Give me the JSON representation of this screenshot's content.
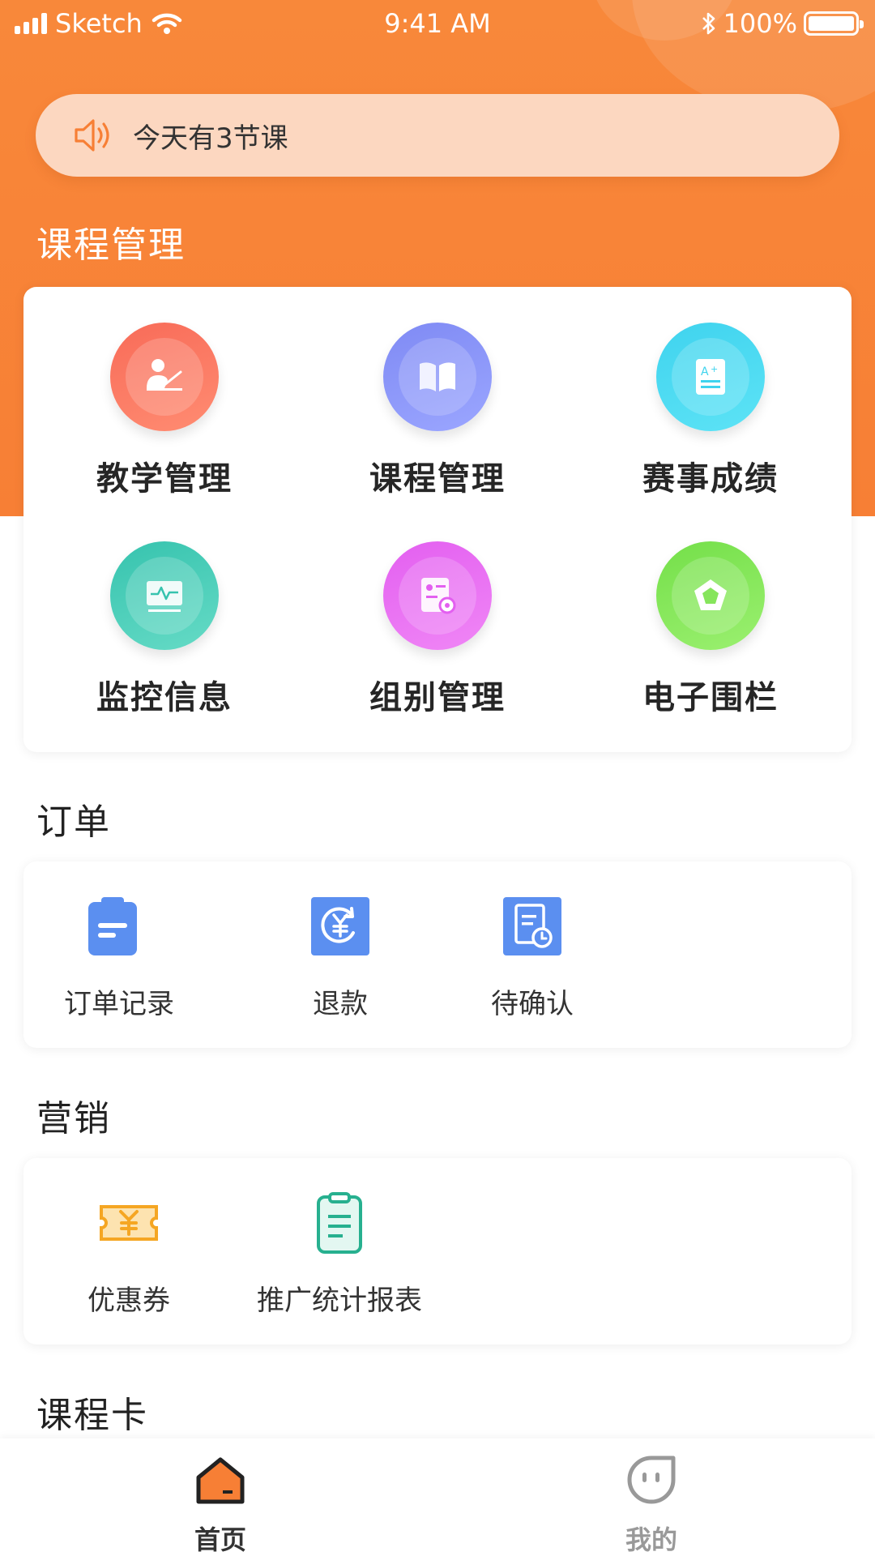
{
  "status_bar": {
    "carrier": "Sketch",
    "time": "9:41 AM",
    "battery": "100%"
  },
  "notice": {
    "text": "今天有3节课",
    "icon": "speaker-icon"
  },
  "course_section": {
    "title": "课程管理",
    "items": [
      {
        "label": "教学管理",
        "icon": "teacher-icon",
        "color": "#f86b58"
      },
      {
        "label": "课程管理",
        "icon": "book-icon",
        "color": "#7f8af4"
      },
      {
        "label": "赛事成绩",
        "icon": "grade-sheet-icon",
        "color": "#3fd3ee"
      },
      {
        "label": "监控信息",
        "icon": "monitor-icon",
        "color": "#36c3ae"
      },
      {
        "label": "组别管理",
        "icon": "group-settings-icon",
        "color": "#e35ff0"
      },
      {
        "label": "电子围栏",
        "icon": "pentagon-fence-icon",
        "color": "#74df49"
      }
    ]
  },
  "order_section": {
    "title": "订单",
    "items": [
      {
        "label": "订单记录",
        "icon": "clipboard-icon"
      },
      {
        "label": "退款",
        "icon": "refund-yen-icon"
      },
      {
        "label": "待确认",
        "icon": "pending-document-icon"
      }
    ]
  },
  "marketing_section": {
    "title": "营销",
    "items": [
      {
        "label": "优惠券",
        "icon": "coupon-icon"
      },
      {
        "label": "推广统计报表",
        "icon": "report-clipboard-icon"
      }
    ]
  },
  "card_section": {
    "title": "课程卡"
  },
  "tabbar": {
    "tabs": [
      {
        "label": "首页",
        "icon": "home-icon",
        "active": true,
        "color": "#333333"
      },
      {
        "label": "我的",
        "icon": "profile-face-icon",
        "active": false,
        "color": "#999999"
      }
    ]
  },
  "colors": {
    "brand": "#f7843a",
    "notice_bg": "#fcd7c0",
    "icon_blue": "#5b8ff0"
  }
}
